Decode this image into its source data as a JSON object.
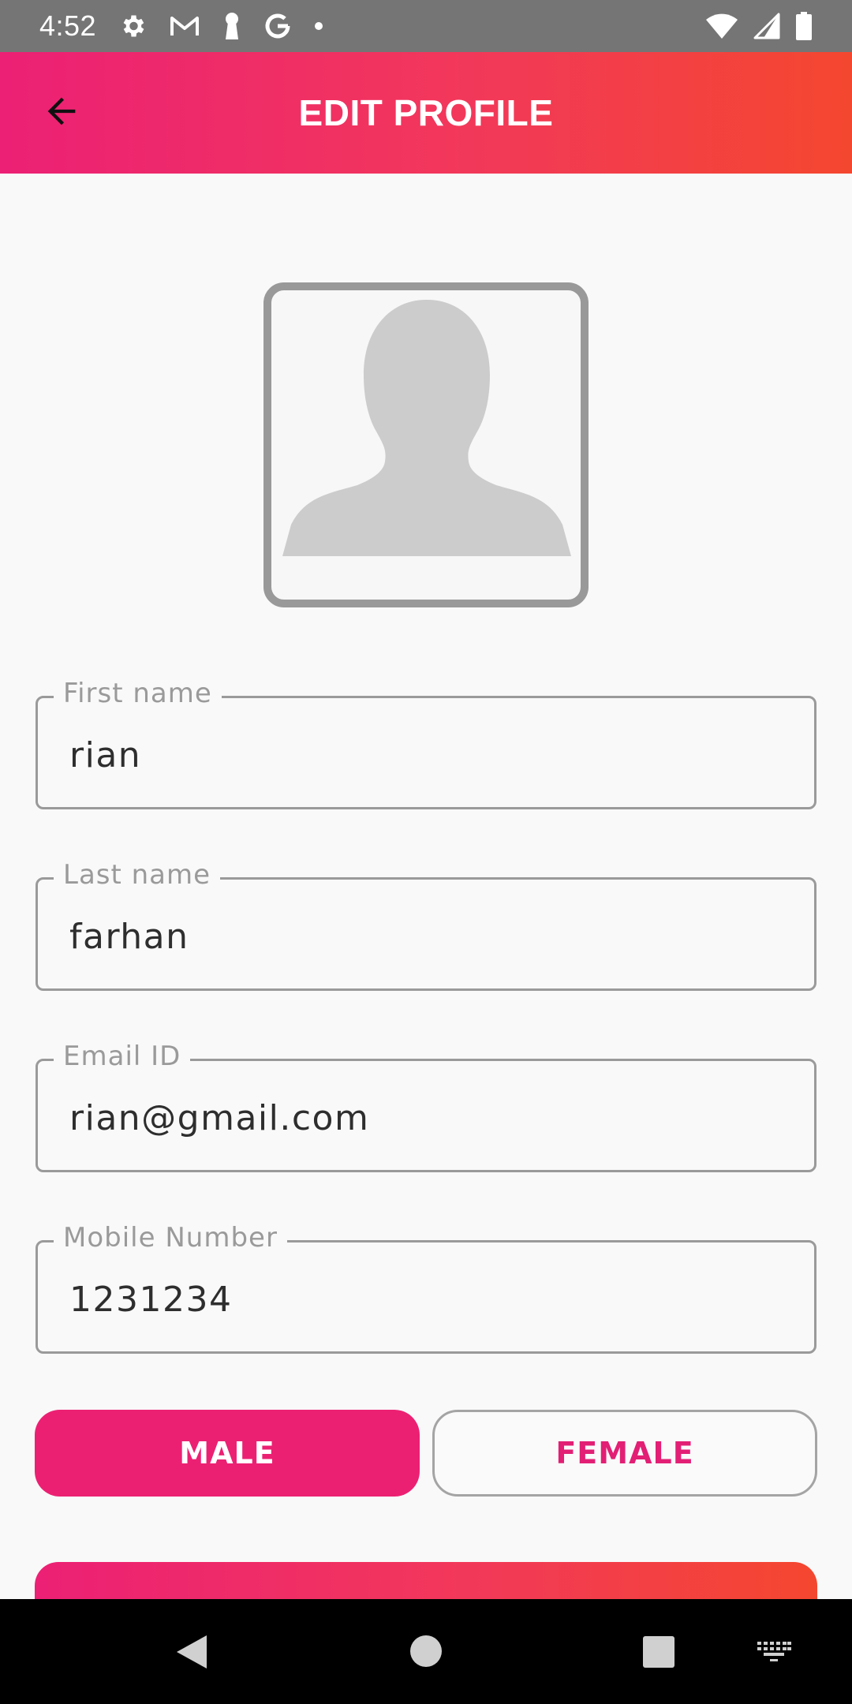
{
  "status_bar": {
    "time": "4:52",
    "left_icons": [
      "gear-icon",
      "gmail-icon",
      "keyhole-icon",
      "google-icon",
      "dot-icon"
    ],
    "right_icons": [
      "wifi-icon",
      "signal-icon",
      "battery-icon"
    ]
  },
  "app_bar": {
    "title": "EDIT PROFILE",
    "back_icon": "arrow-left-icon",
    "gradient": [
      "#ec2075",
      "#f4472f"
    ]
  },
  "avatar": {
    "icon": "person-placeholder-icon"
  },
  "form": {
    "fields": [
      {
        "label": "First name",
        "value": "rian"
      },
      {
        "label": "Last name",
        "value": "farhan"
      },
      {
        "label": "Email ID",
        "value": "rian@gmail.com"
      },
      {
        "label": "Mobile Number",
        "value": "1231234"
      }
    ],
    "gender": {
      "male_label": "MALE",
      "female_label": "FEMALE",
      "selected": "MALE"
    }
  },
  "colors": {
    "accent": "#ec2073",
    "border": "#9a9a9a"
  },
  "nav_bar": {
    "icons": [
      "back-triangle-icon",
      "home-circle-icon",
      "recents-square-icon",
      "keyboard-icon"
    ]
  }
}
